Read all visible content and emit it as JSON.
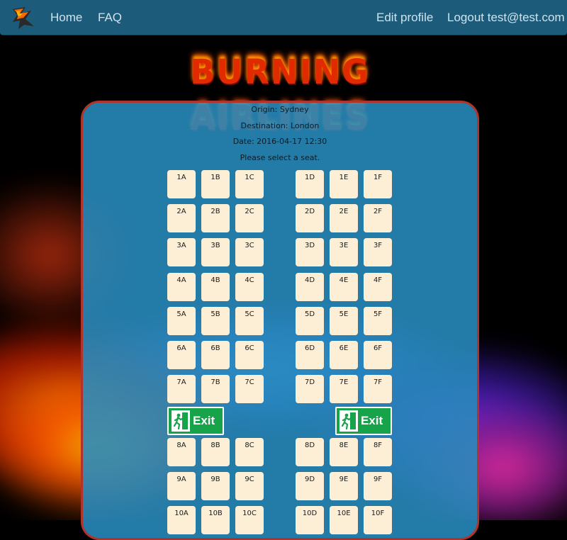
{
  "nav": {
    "home_label": "Home",
    "faq_label": "FAQ",
    "edit_profile_label": "Edit profile",
    "logout_label": "Logout test@test.com"
  },
  "brand": {
    "title": "BURNING AIRLINES"
  },
  "flight": {
    "origin": "Origin: Sydney",
    "destination": "Destination: London",
    "date": "Date: 2016-04-17 12:30",
    "instruction": "Please select a seat."
  },
  "seat_map": {
    "columns": [
      "A",
      "B",
      "C",
      "D",
      "E",
      "F"
    ],
    "rows": [
      [
        "1A",
        "1B",
        "1C",
        "1D",
        "1E",
        "1F"
      ],
      [
        "2A",
        "2B",
        "2C",
        "2D",
        "2E",
        "2F"
      ],
      [
        "3A",
        "3B",
        "3C",
        "3D",
        "3E",
        "3F"
      ],
      [
        "4A",
        "4B",
        "4C",
        "4D",
        "4E",
        "4F"
      ],
      [
        "5A",
        "5B",
        "5C",
        "5D",
        "5E",
        "5F"
      ],
      [
        "6A",
        "6B",
        "6C",
        "6D",
        "6E",
        "6F"
      ],
      [
        "7A",
        "7B",
        "7C",
        "7D",
        "7E",
        "7F"
      ],
      [
        "8A",
        "8B",
        "8C",
        "8D",
        "8E",
        "8F"
      ],
      [
        "9A",
        "9B",
        "9C",
        "9D",
        "9E",
        "9F"
      ],
      [
        "10A",
        "10B",
        "10C",
        "10D",
        "10E",
        "10F"
      ]
    ],
    "exit_label": "Exit",
    "exit_after_row": 7
  },
  "colors": {
    "nav_bg": "#1d5b7a",
    "card_bg": "#288cbe",
    "card_border": "#b2332a",
    "seat_bg": "#fdefd6",
    "exit_green": "#17a34a"
  },
  "icons": {
    "logo": "flame-logo-icon",
    "exit": "running-man-exit-icon"
  }
}
